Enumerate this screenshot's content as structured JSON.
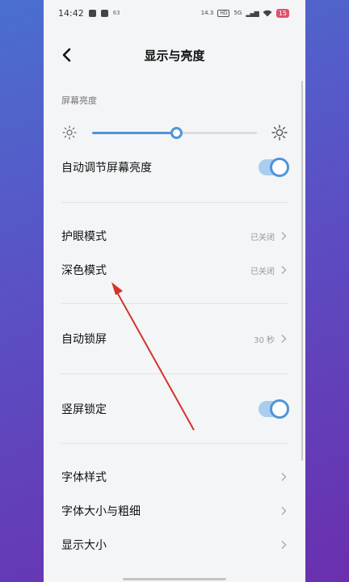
{
  "statusbar": {
    "time": "14:42",
    "small_num": "63",
    "speed": "14.3",
    "net": "5G",
    "battery": "15"
  },
  "header": {
    "title": "显示与亮度"
  },
  "brightness": {
    "section_label": "屏幕亮度",
    "level_percent": 51
  },
  "rows": {
    "auto_brightness": {
      "label": "自动调节屏幕亮度",
      "enabled": true
    },
    "eye_care": {
      "label": "护眼模式",
      "value": "已关闭"
    },
    "dark_mode": {
      "label": "深色模式",
      "value": "已关闭"
    },
    "auto_lock": {
      "label": "自动锁屏",
      "value": "30 秒"
    },
    "portrait_lock": {
      "label": "竖屏锁定",
      "enabled": true
    },
    "font_style": {
      "label": "字体样式"
    },
    "font_size": {
      "label": "字体大小与粗细"
    },
    "display_size": {
      "label": "显示大小"
    }
  },
  "colors": {
    "accent": "#4f95d8",
    "toggle_track": "#a9cdef",
    "annotation": "#d6332b"
  }
}
